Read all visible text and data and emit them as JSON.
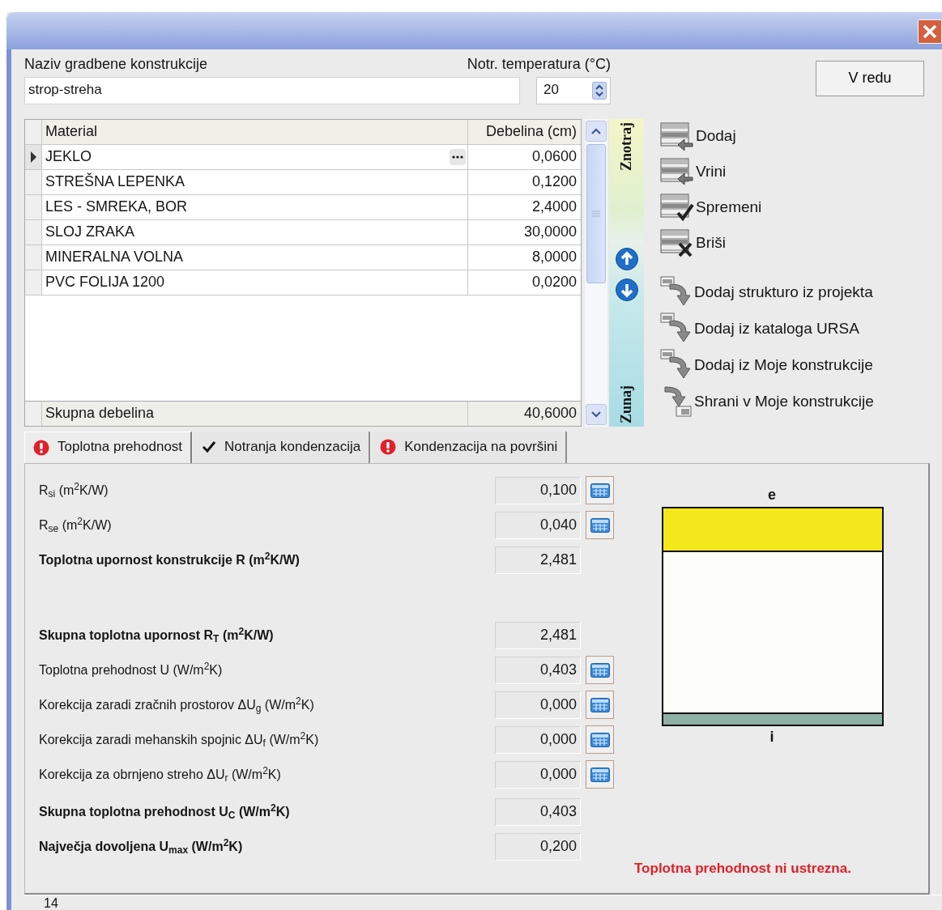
{
  "name_field": {
    "label": "Naziv gradbene konstrukcije",
    "value": "strop-streha"
  },
  "temperature": {
    "label": "Notr. temperatura (°C)",
    "value": "20"
  },
  "ok_button": "V redu",
  "layers_table": {
    "columns": [
      "Material",
      "Debelina (cm)"
    ],
    "rows": [
      {
        "material": "JEKLO",
        "thickness": "0,0600",
        "selected": true
      },
      {
        "material": "STREŠNA LEPENKA",
        "thickness": "0,1200",
        "selected": false
      },
      {
        "material": "LES - SMREKA, BOR",
        "thickness": "2,4000",
        "selected": false
      },
      {
        "material": "SLOJ ZRAKA",
        "thickness": "30,0000",
        "selected": false
      },
      {
        "material": "MINERALNA VOLNA",
        "thickness": "8,0000",
        "selected": false
      },
      {
        "material": "PVC FOLIJA 1200",
        "thickness": "0,0200",
        "selected": false
      }
    ],
    "total": {
      "label": "Skupna debelina",
      "value": "40,6000"
    }
  },
  "side_labels": {
    "inside": "Znotraj",
    "outside": "Zunaj"
  },
  "layer_actions": [
    {
      "kind": "add",
      "label": "Dodaj"
    },
    {
      "kind": "insert",
      "label": "Vrini"
    },
    {
      "kind": "edit",
      "label": "Spremeni"
    },
    {
      "kind": "delete",
      "label": "Briši"
    }
  ],
  "import_actions": [
    {
      "kind": "import",
      "label": "Dodaj strukturo iz projekta"
    },
    {
      "kind": "import",
      "label": "Dodaj iz kataloga URSA"
    },
    {
      "kind": "import",
      "label": "Dodaj iz Moje konstrukcije"
    },
    {
      "kind": "save",
      "label": "Shrani v Moje konstrukcije"
    }
  ],
  "tabs": [
    {
      "label": "Toplotna prehodnost",
      "kind": "error",
      "selected": true
    },
    {
      "label": "Notranja kondenzacija",
      "kind": "ok",
      "selected": false
    },
    {
      "label": "Kondenzacija na površini",
      "kind": "error",
      "selected": false
    }
  ],
  "results": {
    "groups": [
      [
        {
          "label": "R$_{si}$ (m$^{2}$K/W)",
          "bold": false,
          "value": "0,100",
          "calculator": true
        },
        {
          "label": "R$_{se}$ (m$^{2}$K/W)",
          "bold": false,
          "value": "0,040",
          "calculator": true
        },
        {
          "label": "Toplotna upornost konstrukcije R (m$^{2}$K/W)",
          "bold": true,
          "value": "2,481",
          "calculator": false
        }
      ],
      [
        {
          "label": "Skupna toplotna upornost R$_{T}$ (m$^{2}$K/W)",
          "bold": true,
          "value": "2,481",
          "calculator": false
        },
        {
          "label": "Toplotna prehodnost  U (W/m$^{2}$K)",
          "bold": false,
          "value": "0,403",
          "calculator": true
        },
        {
          "label": "Korekcija zaradi zračnih prostorov ΔU$_{g}$ (W/m$^{2}$K)",
          "bold": false,
          "value": "0,000",
          "calculator": true
        },
        {
          "label": "Korekcija zaradi mehanskih spojnic ΔU$_{f}$ (W/m$^{2}$K)",
          "bold": false,
          "value": "0,000",
          "calculator": true
        },
        {
          "label": "Korekcija za obrnjeno streho ΔU$_{r}$ (W/m$^{2}$K)",
          "bold": false,
          "value": "0,000",
          "calculator": true
        }
      ],
      [
        {
          "label": "Skupna toplotna prehodnost U$_{C}$ (W/m$^{2}$K)",
          "bold": true,
          "value": "0,403",
          "calculator": false
        },
        {
          "label": "Največja dovoljena U$_{max}$ (W/m$^{2}$K)",
          "bold": true,
          "value": "0,200",
          "calculator": false
        }
      ]
    ]
  },
  "diagram": {
    "top_label": "e",
    "bottom_label": "i"
  },
  "message": "Toplotna prehodnost ni ustrezna.",
  "status_bar": "14"
}
